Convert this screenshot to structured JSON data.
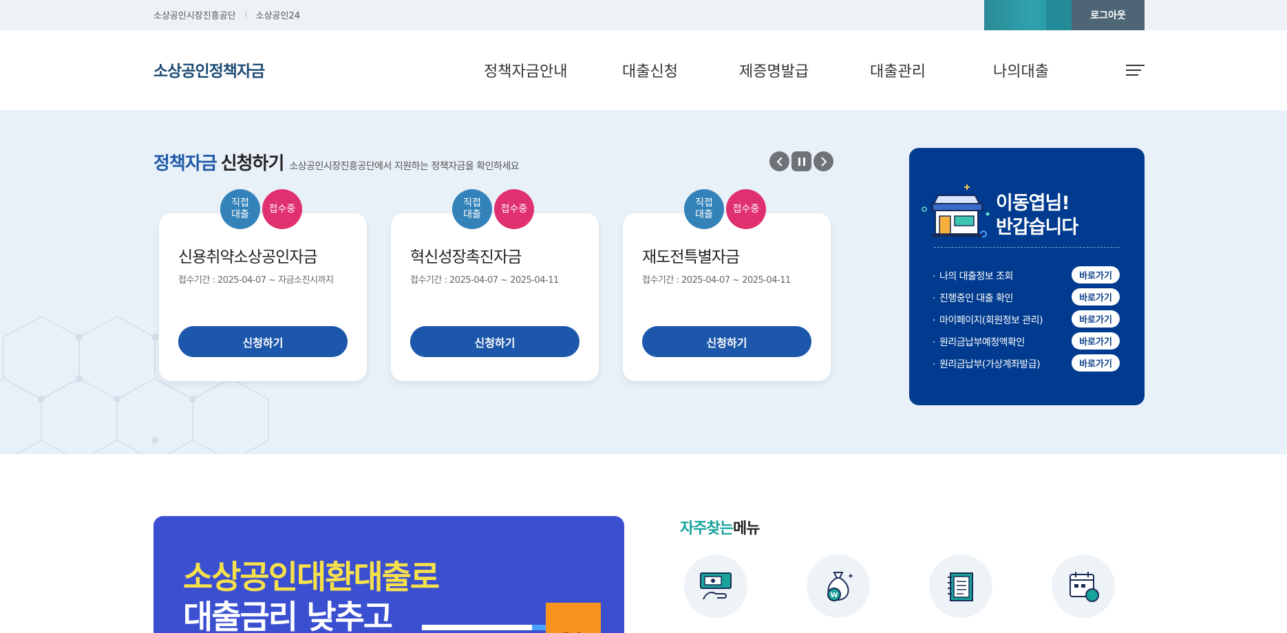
{
  "topbar": {
    "links": [
      "소상공인시장진흥공단",
      "소상공인24"
    ],
    "logout": "로그아웃"
  },
  "header": {
    "logo": "소상공인정책자금",
    "nav": [
      "정책자금안내",
      "대출신청",
      "제증명발급",
      "대출관리",
      "나의대출"
    ]
  },
  "hero": {
    "title_highlight": "정책자금",
    "title_rest": "신청하기",
    "subtitle": "소상공인시장진흥공단에서 지원하는 정책자금을 확인하세요",
    "cards": [
      {
        "badge_type": "직접\n대출",
        "badge_status": "접수중",
        "title": "신용취약소상공인자금",
        "period": "접수기간 : 2025-04-07 ~ 자금소진시까지",
        "button": "신청하기"
      },
      {
        "badge_type": "직접\n대출",
        "badge_status": "접수중",
        "title": "혁신성장촉진자금",
        "period": "접수기간 : 2025-04-07 ~ 2025-04-11",
        "button": "신청하기"
      },
      {
        "badge_type": "직접\n대출",
        "badge_status": "접수중",
        "title": "재도전특별자금",
        "period": "접수기간 : 2025-04-07 ~ 2025-04-11",
        "button": "신청하기"
      }
    ]
  },
  "welcome": {
    "greeting_line1": "이동엽님!",
    "greeting_line2": "반갑습니다",
    "items": [
      {
        "label": "나의 대출정보 조회",
        "button": "바로가기"
      },
      {
        "label": "진행중인 대출 확인",
        "button": "바로가기"
      },
      {
        "label": "마이페이지(회원정보 관리)",
        "button": "바로가기"
      },
      {
        "label": "원리금납부예정액확인",
        "button": "바로가기"
      },
      {
        "label": "원리금납부(가상계좌발급)",
        "button": "바로가기"
      }
    ]
  },
  "banner": {
    "line1": "소상공인대환대출로",
    "line2": "대출금리 낮추고",
    "percent": "%"
  },
  "frequent": {
    "title_highlight": "자주찾는",
    "title_rest": "메뉴"
  },
  "colors": {
    "primary": "#1c57ab",
    "welcome_bg": "#003b8f",
    "status_badge": "#e0306f",
    "type_badge": "#3382b9",
    "banner_bg": "#3b4fd1",
    "accent_teal": "#16a39a"
  }
}
